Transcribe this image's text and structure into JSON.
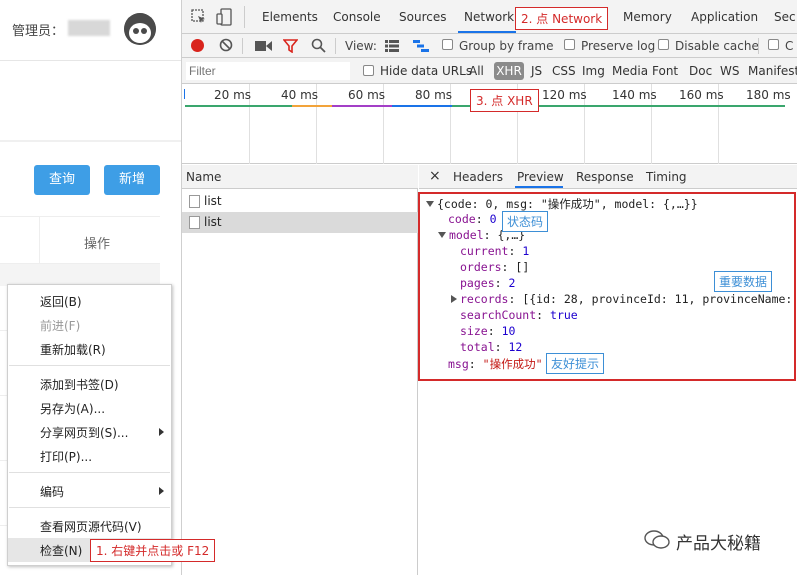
{
  "page": {
    "admin_label": "管理员：",
    "query_button": "查询",
    "add_button": "新增",
    "operation_header": "操作"
  },
  "context_menu": {
    "items": [
      {
        "label": "返回(B)",
        "disabled": false
      },
      {
        "label": "前进(F)",
        "disabled": true
      },
      {
        "label": "重新加载(R)",
        "disabled": false
      },
      {
        "label": "添加到书签(D)",
        "disabled": false
      },
      {
        "label": "另存为(A)...",
        "disabled": false
      },
      {
        "label": "分享网页到(S)...",
        "disabled": false,
        "submenu": true
      },
      {
        "label": "打印(P)...",
        "disabled": false
      },
      {
        "label": "编码",
        "disabled": false,
        "submenu": true
      },
      {
        "label": "查看网页源代码(V)",
        "disabled": false
      },
      {
        "label": "检查(N)",
        "disabled": false,
        "highlighted": true
      }
    ]
  },
  "devtools": {
    "tabs": [
      "Elements",
      "Console",
      "Sources",
      "Network",
      "Memory",
      "Application",
      "Sec"
    ],
    "active_tab": "Network",
    "toolbar": {
      "view_label": "View:",
      "group_by_frame": "Group by frame",
      "preserve_log": "Preserve log",
      "disable_cache": "Disable cache",
      "offline_partial": "C"
    },
    "filter": {
      "placeholder": "Filter",
      "hide_data_urls": "Hide data URLs",
      "types": [
        "All",
        "XHR",
        "JS",
        "CSS",
        "Img",
        "Media",
        "Font",
        "Doc",
        "WS",
        "Manifest"
      ],
      "active_type": "XHR"
    },
    "timeline_ticks": [
      "20 ms",
      "40 ms",
      "60 ms",
      "80 ms",
      "120 ms",
      "140 ms",
      "160 ms",
      "180 ms"
    ],
    "name_header": "Name",
    "requests": [
      {
        "name": "list",
        "selected": false
      },
      {
        "name": "list",
        "selected": true
      }
    ],
    "detail_tabs": [
      "Headers",
      "Preview",
      "Response",
      "Timing"
    ],
    "active_detail_tab": "Preview",
    "close_symbol": "×",
    "preview": {
      "summary": "{code: 0, msg: \"操作成功\", model: {,…}}",
      "code_key": "code",
      "code_val": "0",
      "model_key": "model",
      "model_summary": "{,…}",
      "current_key": "current",
      "current_val": "1",
      "orders_key": "orders",
      "orders_val": "[]",
      "pages_key": "pages",
      "pages_val": "2",
      "records_key": "records",
      "records_val": "[{id: 28, provinceId: 11, provinceName: \"",
      "searchCount_key": "searchCount",
      "searchCount_val": "true",
      "size_key": "size",
      "size_val": "10",
      "total_key": "total",
      "total_val": "12",
      "msg_key": "msg",
      "msg_val": "\"操作成功\""
    }
  },
  "annotations": {
    "step1": "1. 右键并点击或 F12",
    "step2": "2. 点 Network",
    "step3": "3. 点 XHR",
    "status_code": "状态码",
    "important_data": "重要数据",
    "friendly_tip": "友好提示"
  },
  "watermark": "产品大秘籍",
  "colors": {
    "annotation_red": "#d42a2a",
    "annotation_blue": "#3d8fd6",
    "primary_button": "#3e9ee6",
    "active_tab_underline": "#1a73e8"
  }
}
